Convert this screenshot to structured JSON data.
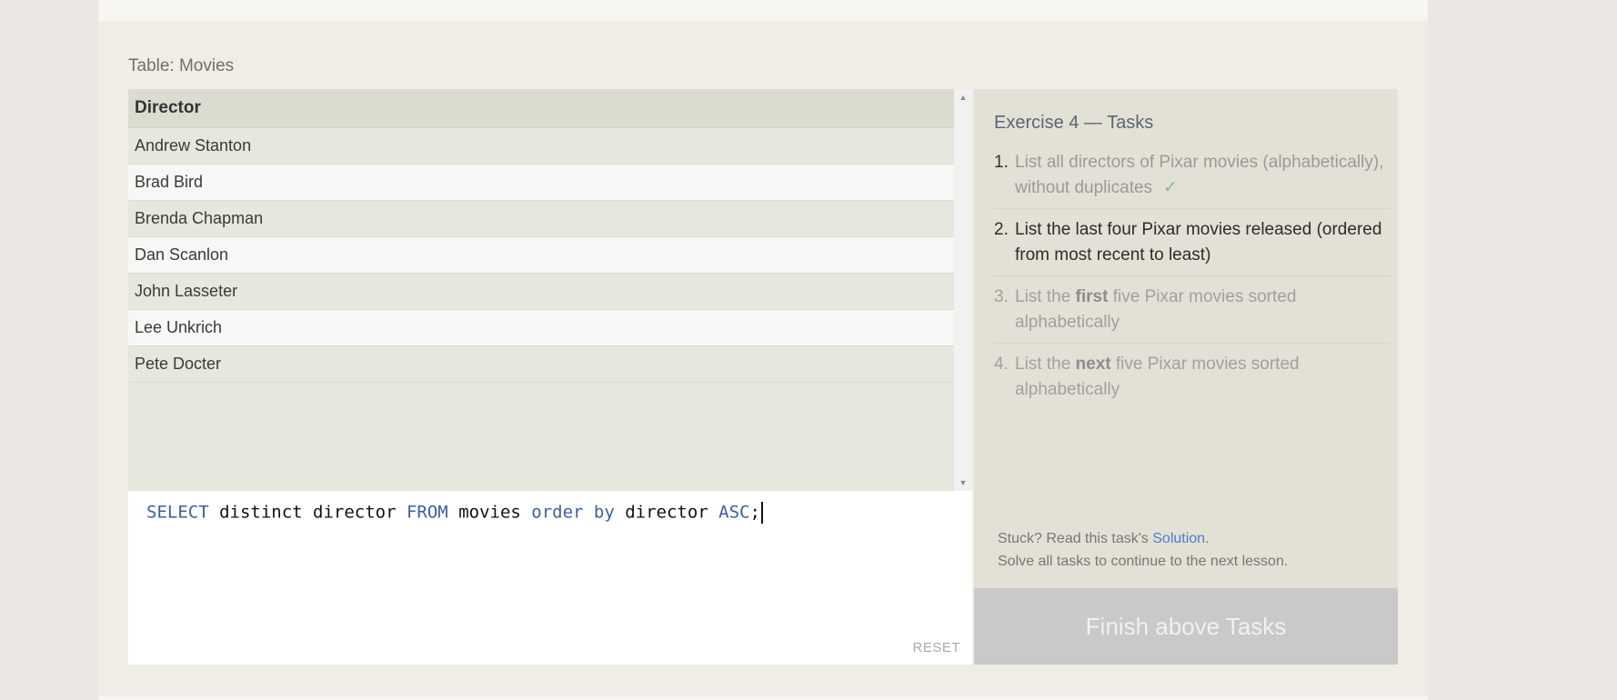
{
  "table": {
    "caption": "Table: Movies",
    "header": "Director",
    "rows": [
      "Andrew Stanton",
      "Brad Bird",
      "Brenda Chapman",
      "Dan Scanlon",
      "John Lasseter",
      "Lee Unkrich",
      "Pete Docter"
    ]
  },
  "editor": {
    "tokens": [
      {
        "text": "SELECT",
        "kw": true
      },
      {
        "text": " distinct director ",
        "kw": false
      },
      {
        "text": "FROM",
        "kw": true
      },
      {
        "text": " movies ",
        "kw": false
      },
      {
        "text": "order by",
        "kw": true
      },
      {
        "text": " director ",
        "kw": false
      },
      {
        "text": "ASC",
        "kw": true
      },
      {
        "text": ";",
        "kw": false
      }
    ],
    "reset_label": "RESET"
  },
  "tasks": {
    "title": "Exercise 4 — Tasks",
    "items": [
      {
        "num": "1.",
        "text": "List all directors of Pixar movies (alphabetically), without duplicates",
        "check": "✓"
      },
      {
        "num": "2.",
        "text": "List the last four Pixar movies released (ordered from most recent to least)"
      },
      {
        "num": "3.",
        "pre": "List the ",
        "bold": "first",
        "post": " five Pixar movies sorted alphabetically"
      },
      {
        "num": "4.",
        "pre": "List the ",
        "bold": "next",
        "post": " five Pixar movies sorted alphabetically"
      }
    ],
    "stuck_prefix": "Stuck? Read this task's ",
    "solution_label": "Solution",
    "stuck_suffix": ".",
    "continue_text": "Solve all tasks to continue to the next lesson.",
    "finish_label": "Finish above Tasks"
  },
  "colors": {
    "keyword": "#3d5f9e",
    "check": "#7ec27e",
    "link": "#4a7bd0"
  }
}
